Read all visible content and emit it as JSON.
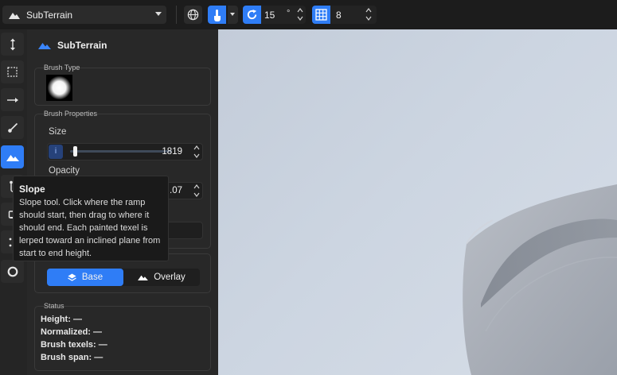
{
  "topbar": {
    "terrain_name": "SubTerrain",
    "rotation_value": "15",
    "rotation_unit": "°",
    "grid_value": "8",
    "icons": [
      "mountain-icon",
      "globe-icon",
      "hand-pointer-icon",
      "rotate-icon",
      "grid-icon"
    ]
  },
  "toolbar": {
    "tools": [
      "raise-lower",
      "select-region",
      "smooth-arrow",
      "paint-brush",
      "slope",
      "terrace",
      "stamp",
      "noise",
      "erode"
    ],
    "active": "slope"
  },
  "panel": {
    "title": "SubTerrain",
    "brush_type_label": "Brush Type",
    "brush_properties_label": "Brush Properties",
    "size_label": "Size",
    "size_value": "1819",
    "size_info": "i",
    "size_fraction": 0.05,
    "opacity_label": "Opacity",
    "opacity_value_visible": ".07",
    "mode": {
      "base_label": "Base",
      "overlay_label": "Overlay",
      "active": "Base"
    },
    "status": {
      "label": "Status",
      "height": "Height: —",
      "normalized": "Normalized: —",
      "brush_texels": "Brush texels: —",
      "brush_span": "Brush span: —"
    }
  },
  "tooltip": {
    "title": "Slope",
    "body": "Slope tool. Click where the ramp should start, then drag to where it should end. Each painted texel is lerped toward an inclined plane from start to end height."
  },
  "colors": {
    "accent": "#2f7df6",
    "panel_bg": "#282828",
    "topbar_bg": "#1c1c1c",
    "viewport_sky": "#cdd6e2"
  }
}
